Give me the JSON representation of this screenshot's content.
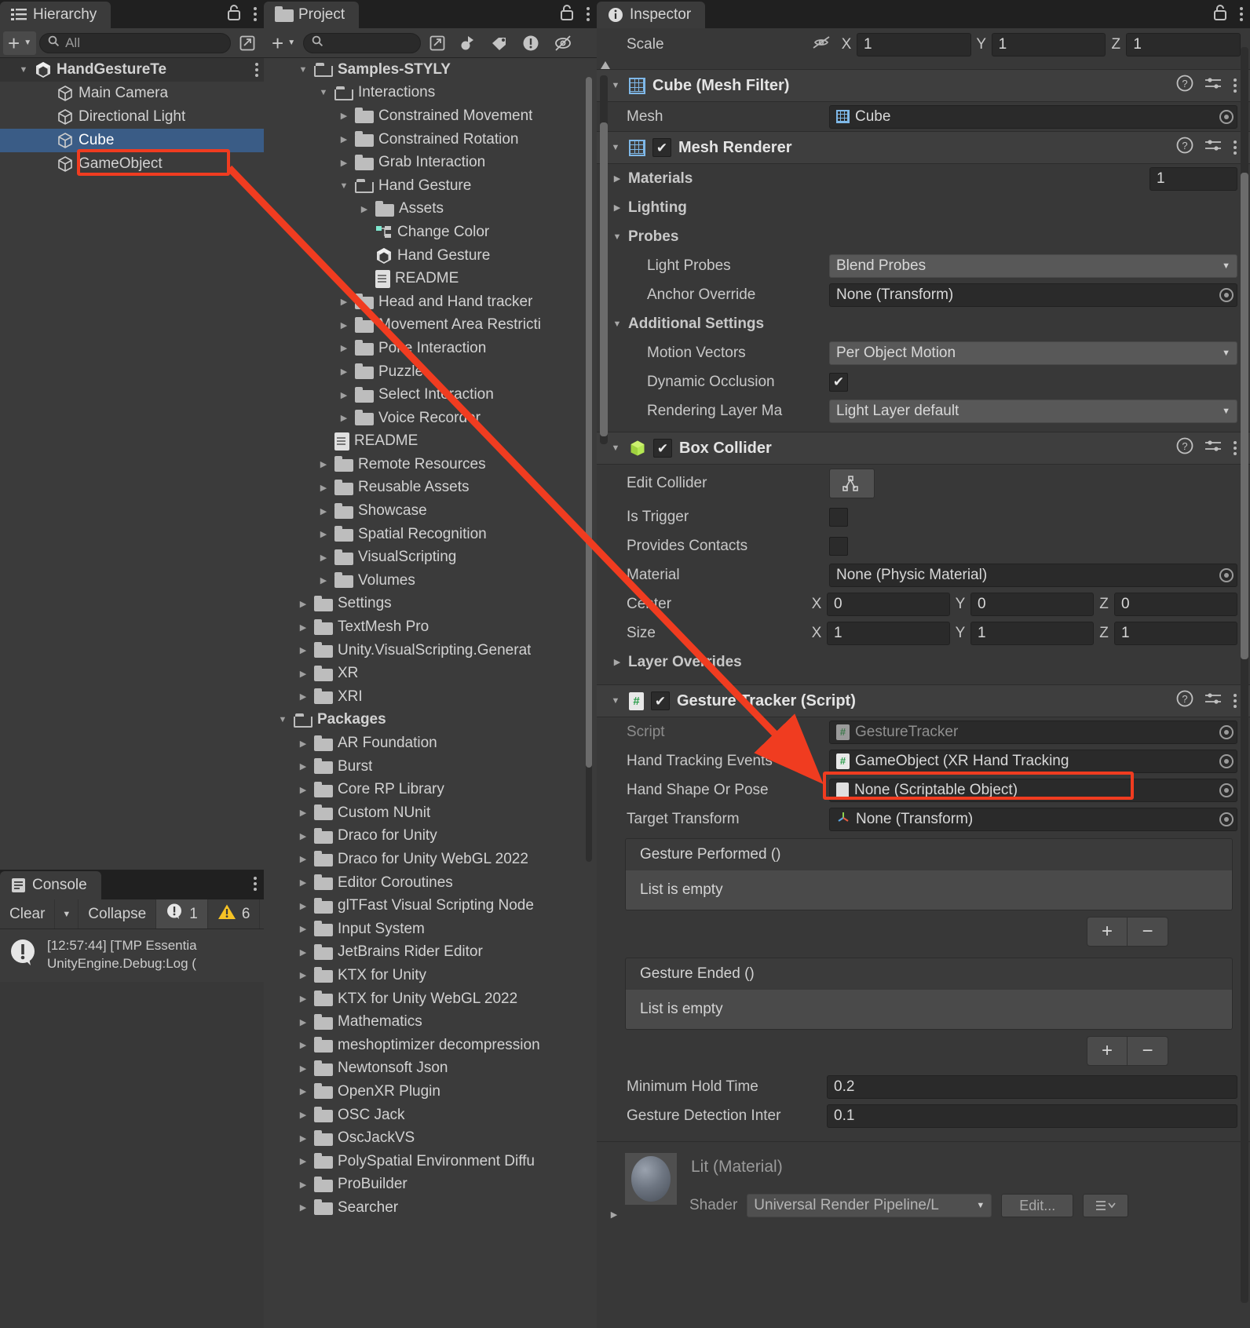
{
  "hierarchy": {
    "tab_title": "Hierarchy",
    "icon": "hierarchy-icon",
    "add_label": "+",
    "search_placeholder": "All",
    "items": [
      {
        "label": "HandGestureTe",
        "icon": "unity-scene-icon",
        "depth": 0,
        "expanded": true,
        "selected": false,
        "root": true
      },
      {
        "label": "Main Camera",
        "icon": "gameobject-cube-icon",
        "depth": 1,
        "expanded": null,
        "selected": false,
        "root": false
      },
      {
        "label": "Directional Light",
        "icon": "gameobject-cube-icon",
        "depth": 1,
        "expanded": null,
        "selected": false,
        "root": false
      },
      {
        "label": "Cube",
        "icon": "gameobject-cube-icon",
        "depth": 1,
        "expanded": null,
        "selected": true,
        "root": false
      },
      {
        "label": "GameObject",
        "icon": "gameobject-cube-icon",
        "depth": 1,
        "expanded": null,
        "selected": false,
        "root": false
      }
    ]
  },
  "project": {
    "tab_title": "Project",
    "icon": "folder-icon",
    "add_label": "+",
    "search_placeholder": "",
    "items": [
      {
        "label": "Samples-STYLY",
        "icon": "folder-open-icon",
        "depth": 1,
        "expanded": true,
        "bold": true
      },
      {
        "label": "Interactions",
        "icon": "folder-open-icon",
        "depth": 2,
        "expanded": true,
        "bold": false
      },
      {
        "label": "Constrained Movement",
        "icon": "folder-icon",
        "depth": 3,
        "expanded": false,
        "bold": false
      },
      {
        "label": "Constrained Rotation",
        "icon": "folder-icon",
        "depth": 3,
        "expanded": false,
        "bold": false
      },
      {
        "label": "Grab Interaction",
        "icon": "folder-icon",
        "depth": 3,
        "expanded": false,
        "bold": false
      },
      {
        "label": "Hand Gesture",
        "icon": "folder-open-icon",
        "depth": 3,
        "expanded": true,
        "bold": false
      },
      {
        "label": "Assets",
        "icon": "folder-icon",
        "depth": 4,
        "expanded": false,
        "bold": false
      },
      {
        "label": "Change Color",
        "icon": "visual-script-icon",
        "depth": 4,
        "expanded": null,
        "bold": false
      },
      {
        "label": "Hand Gesture",
        "icon": "unity-scene-icon",
        "depth": 4,
        "expanded": null,
        "bold": false
      },
      {
        "label": "README",
        "icon": "text-doc-icon",
        "depth": 4,
        "expanded": null,
        "bold": false
      },
      {
        "label": "Head and Hand tracker",
        "icon": "folder-icon",
        "depth": 3,
        "expanded": false,
        "bold": false
      },
      {
        "label": "Movement Area Restricti",
        "icon": "folder-icon",
        "depth": 3,
        "expanded": false,
        "bold": false
      },
      {
        "label": "Poke Interaction",
        "icon": "folder-icon",
        "depth": 3,
        "expanded": false,
        "bold": false
      },
      {
        "label": "Puzzle",
        "icon": "folder-icon",
        "depth": 3,
        "expanded": false,
        "bold": false
      },
      {
        "label": "Select Interaction",
        "icon": "folder-icon",
        "depth": 3,
        "expanded": false,
        "bold": false
      },
      {
        "label": "Voice Recorder",
        "icon": "folder-icon",
        "depth": 3,
        "expanded": false,
        "bold": false
      },
      {
        "label": "README",
        "icon": "text-doc-icon",
        "depth": 2,
        "expanded": null,
        "bold": false
      },
      {
        "label": "Remote Resources",
        "icon": "folder-icon",
        "depth": 2,
        "expanded": false,
        "bold": false
      },
      {
        "label": "Reusable Assets",
        "icon": "folder-icon",
        "depth": 2,
        "expanded": false,
        "bold": false
      },
      {
        "label": "Showcase",
        "icon": "folder-icon",
        "depth": 2,
        "expanded": false,
        "bold": false
      },
      {
        "label": "Spatial Recognition",
        "icon": "folder-icon",
        "depth": 2,
        "expanded": false,
        "bold": false
      },
      {
        "label": "VisualScripting",
        "icon": "folder-icon",
        "depth": 2,
        "expanded": false,
        "bold": false
      },
      {
        "label": "Volumes",
        "icon": "folder-icon",
        "depth": 2,
        "expanded": false,
        "bold": false
      },
      {
        "label": "Settings",
        "icon": "folder-icon",
        "depth": 1,
        "expanded": false,
        "bold": false
      },
      {
        "label": "TextMesh Pro",
        "icon": "folder-icon",
        "depth": 1,
        "expanded": false,
        "bold": false
      },
      {
        "label": "Unity.VisualScripting.Generat",
        "icon": "folder-icon",
        "depth": 1,
        "expanded": false,
        "bold": false
      },
      {
        "label": "XR",
        "icon": "folder-icon",
        "depth": 1,
        "expanded": false,
        "bold": false
      },
      {
        "label": "XRI",
        "icon": "folder-icon",
        "depth": 1,
        "expanded": false,
        "bold": false
      },
      {
        "label": "Packages",
        "icon": "folder-open-icon",
        "depth": 0,
        "expanded": true,
        "bold": true
      },
      {
        "label": "AR Foundation",
        "icon": "folder-icon",
        "depth": 1,
        "expanded": false,
        "bold": false
      },
      {
        "label": "Burst",
        "icon": "folder-icon",
        "depth": 1,
        "expanded": false,
        "bold": false
      },
      {
        "label": "Core RP Library",
        "icon": "folder-icon",
        "depth": 1,
        "expanded": false,
        "bold": false
      },
      {
        "label": "Custom NUnit",
        "icon": "folder-icon",
        "depth": 1,
        "expanded": false,
        "bold": false
      },
      {
        "label": "Draco for Unity",
        "icon": "folder-icon",
        "depth": 1,
        "expanded": false,
        "bold": false
      },
      {
        "label": "Draco for Unity WebGL 2022",
        "icon": "folder-icon",
        "depth": 1,
        "expanded": false,
        "bold": false
      },
      {
        "label": "Editor Coroutines",
        "icon": "folder-icon",
        "depth": 1,
        "expanded": false,
        "bold": false
      },
      {
        "label": "glTFast Visual Scripting Node",
        "icon": "folder-icon",
        "depth": 1,
        "expanded": false,
        "bold": false
      },
      {
        "label": "Input System",
        "icon": "folder-icon",
        "depth": 1,
        "expanded": false,
        "bold": false
      },
      {
        "label": "JetBrains Rider Editor",
        "icon": "folder-icon",
        "depth": 1,
        "expanded": false,
        "bold": false
      },
      {
        "label": "KTX for Unity",
        "icon": "folder-icon",
        "depth": 1,
        "expanded": false,
        "bold": false
      },
      {
        "label": "KTX for Unity WebGL 2022",
        "icon": "folder-icon",
        "depth": 1,
        "expanded": false,
        "bold": false
      },
      {
        "label": "Mathematics",
        "icon": "folder-icon",
        "depth": 1,
        "expanded": false,
        "bold": false
      },
      {
        "label": "meshoptimizer decompression",
        "icon": "folder-icon",
        "depth": 1,
        "expanded": false,
        "bold": false
      },
      {
        "label": "Newtonsoft Json",
        "icon": "folder-icon",
        "depth": 1,
        "expanded": false,
        "bold": false
      },
      {
        "label": "OpenXR Plugin",
        "icon": "folder-icon",
        "depth": 1,
        "expanded": false,
        "bold": false
      },
      {
        "label": "OSC Jack",
        "icon": "folder-icon",
        "depth": 1,
        "expanded": false,
        "bold": false
      },
      {
        "label": "OscJackVS",
        "icon": "folder-icon",
        "depth": 1,
        "expanded": false,
        "bold": false
      },
      {
        "label": "PolySpatial Environment Diffu",
        "icon": "folder-icon",
        "depth": 1,
        "expanded": false,
        "bold": false
      },
      {
        "label": "ProBuilder",
        "icon": "folder-icon",
        "depth": 1,
        "expanded": false,
        "bold": false
      },
      {
        "label": "Searcher",
        "icon": "folder-icon",
        "depth": 1,
        "expanded": false,
        "bold": false
      }
    ]
  },
  "inspector": {
    "tab_title": "Inspector",
    "icon": "info-icon",
    "transform_scale": {
      "label": "Scale",
      "x_axis": "X",
      "x": "1",
      "y_axis": "Y",
      "y": "1",
      "z_axis": "Z",
      "z": "1"
    },
    "components": [
      {
        "title": "Cube (Mesh Filter)",
        "icon": "mesh-filter-icon",
        "has_checkbox": false,
        "mesh_label": "Mesh",
        "mesh_value": "Cube"
      },
      {
        "title": "Mesh Renderer",
        "icon": "mesh-renderer-icon",
        "has_checkbox": true,
        "checked": true,
        "materials_label": "Materials",
        "materials_count": "1",
        "lighting_label": "Lighting",
        "probes_label": "Probes",
        "light_probes_label": "Light Probes",
        "light_probes_value": "Blend Probes",
        "anchor_override_label": "Anchor Override",
        "anchor_override_value": "None (Transform)",
        "additional_settings_label": "Additional Settings",
        "motion_vectors_label": "Motion Vectors",
        "motion_vectors_value": "Per Object Motion",
        "dynamic_occlusion_label": "Dynamic Occlusion",
        "dynamic_occlusion_checked": true,
        "rendering_layer_label": "Rendering Layer Ma",
        "rendering_layer_value": "Light Layer default"
      },
      {
        "title": "Box Collider",
        "icon": "box-collider-icon",
        "has_checkbox": true,
        "checked": true,
        "edit_collider_label": "Edit Collider",
        "is_trigger_label": "Is Trigger",
        "provides_contacts_label": "Provides Contacts",
        "material_label": "Material",
        "material_value": "None (Physic Material)",
        "center_label": "Center",
        "center": {
          "x_axis": "X",
          "x": "0",
          "y_axis": "Y",
          "y": "0",
          "z_axis": "Z",
          "z": "0"
        },
        "size_label": "Size",
        "size": {
          "x_axis": "X",
          "x": "1",
          "y_axis": "Y",
          "y": "1",
          "z_axis": "Z",
          "z": "1"
        },
        "layer_overrides_label": "Layer Overrides"
      },
      {
        "title": "Gesture Tracker (Script)",
        "icon": "cs-script-icon",
        "has_checkbox": true,
        "checked": true,
        "script_label": "Script",
        "script_value": "GestureTracker",
        "hand_tracking_events_label": "Hand Tracking Events",
        "hand_tracking_events_value": "GameObject (XR Hand Tracking",
        "hand_shape_label": "Hand Shape Or Pose",
        "hand_shape_value": "None (Scriptable Object)",
        "target_transform_label": "Target Transform",
        "target_transform_value": "None (Transform)",
        "gesture_performed_label": "Gesture Performed ()",
        "gesture_performed_empty": "List is empty",
        "gesture_ended_label": "Gesture Ended ()",
        "gesture_ended_empty": "List is empty",
        "add_label": "+",
        "remove_label": "−",
        "minimum_hold_time_label": "Minimum Hold Time",
        "minimum_hold_time_value": "0.2",
        "gesture_detection_label": "Gesture Detection Inter",
        "gesture_detection_value": "0.1"
      }
    ],
    "material_preview": {
      "title": "Lit (Material)",
      "shader_label": "Shader",
      "shader_value": "Universal Render Pipeline/L",
      "edit_label": "Edit..."
    }
  },
  "console": {
    "tab_title": "Console",
    "icon": "console-icon",
    "clear_label": "Clear",
    "collapse_label": "Collapse",
    "error_count": "1",
    "warning_count": "6",
    "log_entry": {
      "line1": "[12:57:44] [TMP Essentia",
      "line2": "UnityEngine.Debug:Log ("
    }
  },
  "annotation": {
    "highlight_color": "#f03c20",
    "arrow_from": "GameObject (hierarchy)",
    "arrow_to": "Hand Tracking Events field"
  }
}
